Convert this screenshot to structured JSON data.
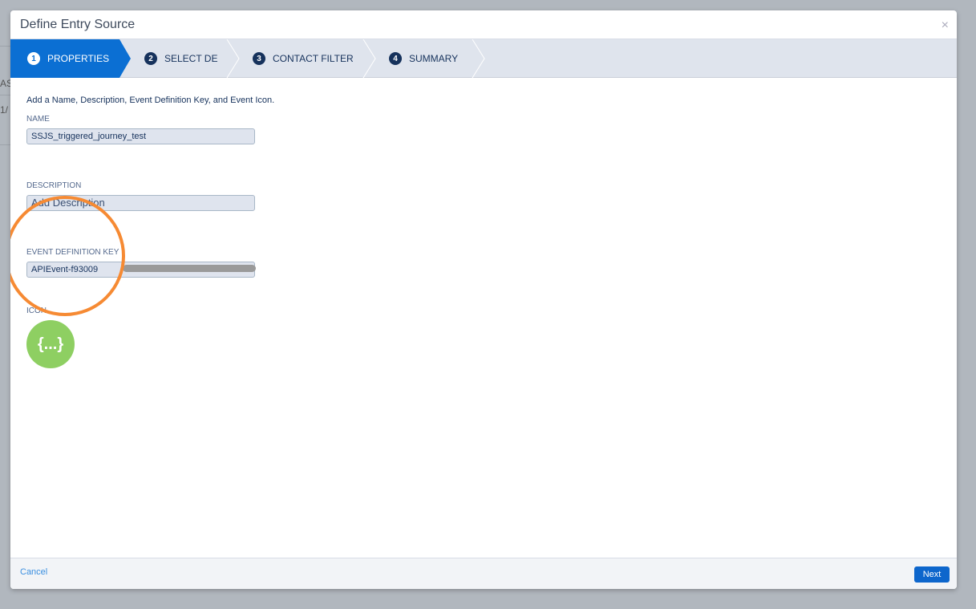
{
  "background": {
    "fragment_1": "AS",
    "fragment_2": "1/"
  },
  "modal": {
    "title": "Define Entry Source",
    "close_icon": "×",
    "steps": [
      {
        "number": "1",
        "label": "PROPERTIES",
        "active": true
      },
      {
        "number": "2",
        "label": "SELECT DE"
      },
      {
        "number": "3",
        "label": "CONTACT FILTER"
      },
      {
        "number": "4",
        "label": "SUMMARY"
      }
    ],
    "intro": "Add a Name, Description, Event Definition Key, and Event Icon.",
    "name": {
      "label": "NAME",
      "value": "SSJS_triggered_journey_test"
    },
    "description": {
      "label": "DESCRIPTION",
      "placeholder": "Add Description"
    },
    "event_key": {
      "label": "EVENT DEFINITION KEY",
      "value": "APIEvent-f93009"
    },
    "icon": {
      "label": "ICON",
      "glyph": "{...}",
      "color": "#8ecf62"
    },
    "footer": {
      "cancel": "Cancel",
      "next": "Next"
    },
    "colors": {
      "accent": "#0b6fd3",
      "annotation": "#f68a33"
    }
  }
}
